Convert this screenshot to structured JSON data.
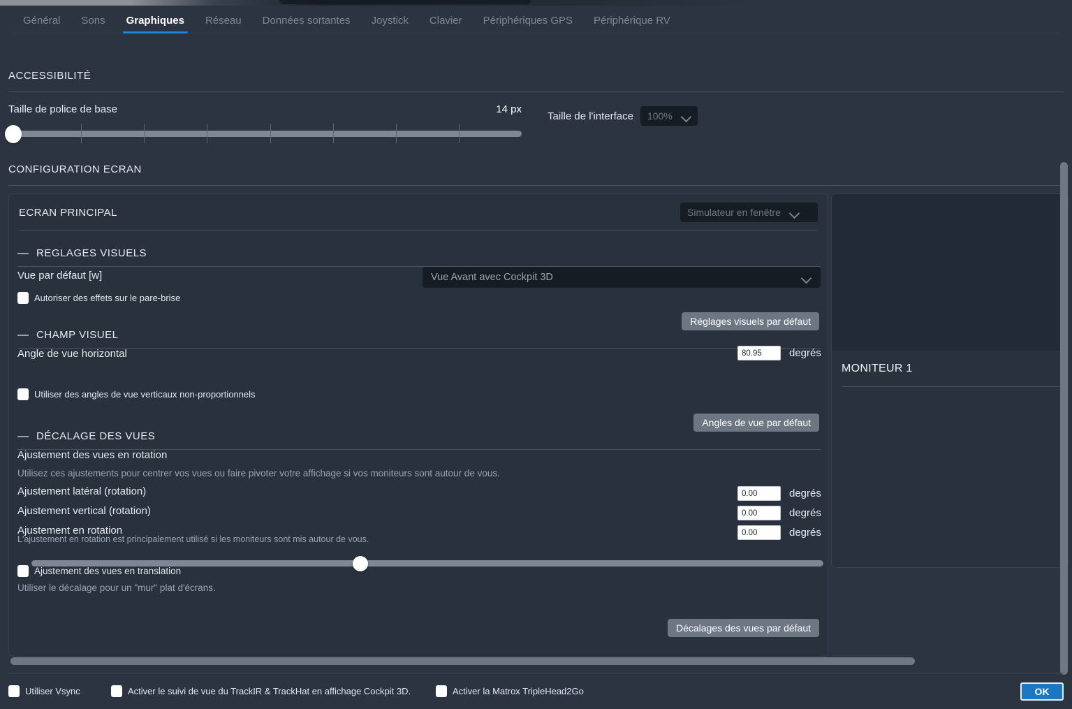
{
  "window": {
    "title": "Graphiques"
  },
  "tabs": [
    {
      "label": "Général",
      "active": false
    },
    {
      "label": "Sons",
      "active": false
    },
    {
      "label": "Graphiques",
      "active": true
    },
    {
      "label": "Réseau",
      "active": false
    },
    {
      "label": "Données sortantes",
      "active": false
    },
    {
      "label": "Joystick",
      "active": false
    },
    {
      "label": "Clavier",
      "active": false
    },
    {
      "label": "Périphériques GPS",
      "active": false
    },
    {
      "label": "Périphérique RV",
      "active": false
    }
  ],
  "accessibility": {
    "heading": "ACCESSIBILITÉ",
    "font_size": {
      "label": "Taille de police de base",
      "value": "14 px",
      "percent": 1,
      "ticks": 7
    },
    "interface_size": {
      "label": "Taille de l'interface",
      "value": "100%"
    }
  },
  "screen_config": {
    "heading": "CONFIGURATION ECRAN",
    "main_screen": {
      "title": "ECRAN PRINCIPAL",
      "mode": "Simulateur en fenêtre"
    },
    "visual_settings": {
      "title": "REGLAGES VISUELS",
      "default_view": {
        "label": "Vue par défaut [w]",
        "value": "Vue Avant avec Cockpit 3D"
      },
      "windshield_effects": {
        "label": "Autoriser des effets sur le pare-brise",
        "checked": false
      },
      "reset_button": "Réglages visuels par défaut"
    },
    "field_of_view": {
      "title": "CHAMP VISUEL",
      "horizontal_angle": {
        "label": "Angle de vue horizontal",
        "value": "80.95",
        "unit": "degrés",
        "percent": 41.5
      },
      "non_proportional": {
        "label": "Utiliser des angles de vue verticaux non-proportionnels",
        "checked": false
      },
      "reset_button": "Angles de vue par défaut"
    },
    "view_offset": {
      "title": "DÉCALAGE DES VUES",
      "rotation_heading": "Ajustement des vues en rotation",
      "rotation_hint": "Utilisez ces ajustements pour centrer vos vues ou faire pivoter votre affichage si vos moniteurs sont autour de vous.",
      "fields": [
        {
          "label": "Ajustement latéral (rotation)",
          "value": "0.00",
          "unit": "degrés"
        },
        {
          "label": "Ajustement vertical (rotation)",
          "value": "0.00",
          "unit": "degrés"
        },
        {
          "label": "Ajustement en rotation",
          "value": "0.00",
          "unit": "degrés"
        }
      ],
      "rotation_note": "L'ajustement en rotation est principalement utilisé si les moniteurs sont mis autour de vous.",
      "translation": {
        "label": "Ajustement des vues en translation",
        "checked": false
      },
      "translation_hint": "Utiliser le décalage pour un \"mur\" plat d'écrans.",
      "reset_button": "Décalages des vues par défaut"
    },
    "monitor_panel": {
      "title": "MONITEUR 1"
    }
  },
  "footer": {
    "checkboxes": [
      {
        "label": "Utiliser Vsync",
        "checked": false
      },
      {
        "label": "Activer le suivi de vue du TrackIR & TrackHat en affichage Cockpit 3D.",
        "checked": false
      },
      {
        "label": "Activer la Matrox TripleHead2Go",
        "checked": false
      }
    ],
    "ok_label": "OK"
  },
  "colors": {
    "background": "#2b3440",
    "card": "#29313d",
    "accent": "#1e88d4",
    "ok_button": "#1a78c2",
    "input_dark": "#161c24",
    "button_grey": "#6d7683"
  }
}
